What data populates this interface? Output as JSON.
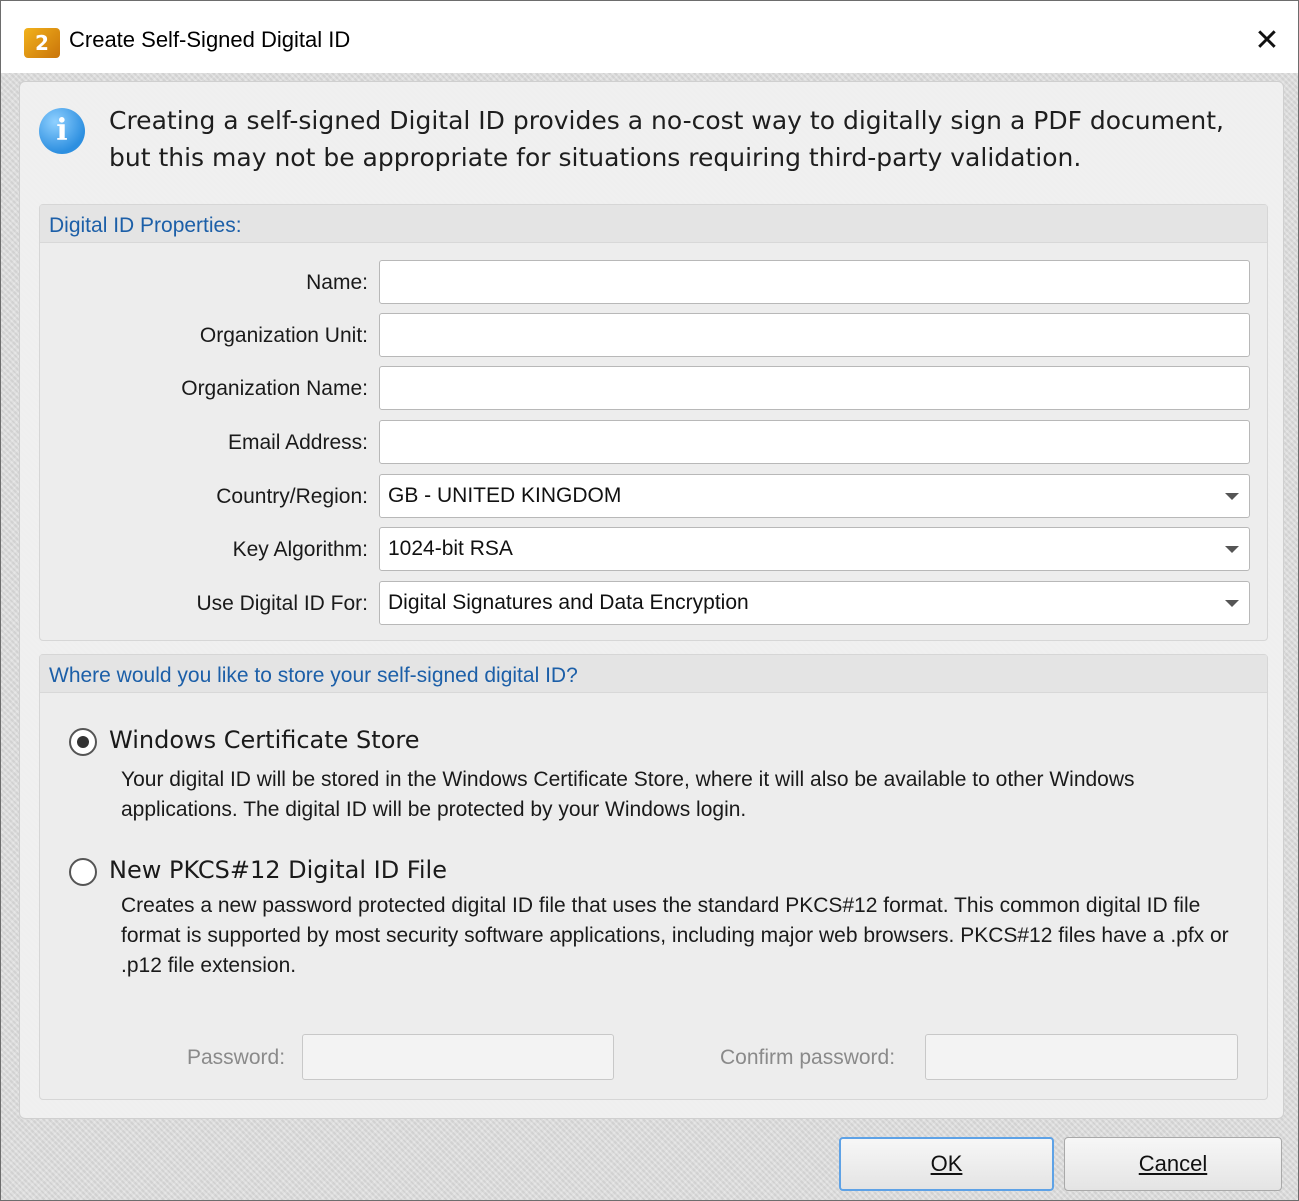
{
  "window": {
    "title": "Create Self-Signed Digital ID",
    "close_glyph": "✕",
    "app_icon_glyph": "2"
  },
  "info": {
    "text": "Creating a self-signed Digital ID provides a no-cost way to digitally sign a PDF document, but this may not be appropriate for situations requiring third-party validation.",
    "icon_glyph": "i"
  },
  "properties": {
    "title": "Digital ID Properties:",
    "name_label": "Name:",
    "name_value": "",
    "org_unit_label": "Organization Unit:",
    "org_unit_value": "",
    "org_name_label": "Organization Name:",
    "org_name_value": "",
    "email_label": "Email Address:",
    "email_value": "",
    "country_label": "Country/Region:",
    "country_value": "GB - UNITED KINGDOM",
    "key_label": "Key Algorithm:",
    "key_value": "1024-bit RSA",
    "use_label": "Use Digital ID For:",
    "use_value": "Digital Signatures and Data Encryption"
  },
  "storage": {
    "title": "Where would you like to store your self-signed digital ID?",
    "option1_label": "Windows Certificate Store",
    "option1_desc": "Your digital ID will be stored in the Windows Certificate Store, where it will also be available to other Windows applications. The digital ID will be protected by your Windows login.",
    "option2_label": "New PKCS#12 Digital ID File",
    "option2_desc": "Creates a new password protected digital ID file that uses the standard PKCS#12 format. This common digital ID file format is supported by most security software applications, including major web browsers. PKCS#12 files have a .pfx or .p12 file extension.",
    "password_label": "Password:",
    "confirm_label": "Confirm password:"
  },
  "buttons": {
    "ok": "OK",
    "cancel": "Cancel"
  }
}
